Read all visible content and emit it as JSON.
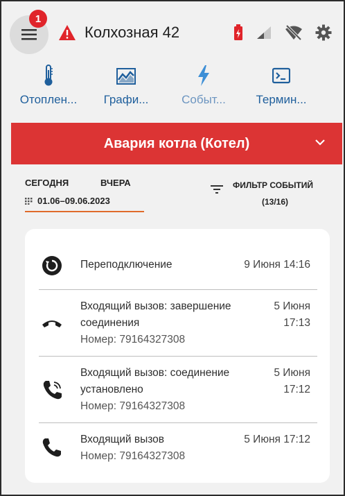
{
  "header": {
    "notification_count": "1",
    "title": "Колхозная 42",
    "icons": [
      "menu-icon",
      "warning-icon",
      "battery-icon",
      "signal-icon",
      "no-wifi-icon",
      "gear-icon"
    ]
  },
  "nav": {
    "items": [
      {
        "label": "Отоплен...",
        "icon": "thermometer-icon"
      },
      {
        "label": "Графи...",
        "icon": "chart-icon"
      },
      {
        "label": "Событ...",
        "icon": "lightning-icon"
      },
      {
        "label": "Термин...",
        "icon": "terminal-icon"
      }
    ]
  },
  "alarm": {
    "text": "Авария котла (Котел)",
    "color": "#dc3434"
  },
  "filters": {
    "today": "СЕГОДНЯ",
    "yesterday": "ВЧЕРА",
    "date_range": "01.06–09.06.2023",
    "filter_label": "ФИЛЬТР СОБЫТИЙ",
    "filter_count": "(13/16)"
  },
  "events": [
    {
      "icon": "reconnect-icon",
      "title": "Переподключение",
      "sub": "",
      "time": "9 Июня 14:16"
    },
    {
      "icon": "hangup-icon",
      "title": "Входящий вызов: завершение соединения",
      "sub": "Номер: 79164327308",
      "time": "5 Июня 17:13"
    },
    {
      "icon": "phone-ringing-icon",
      "title": "Входящий вызов: соединение установлено",
      "sub": "Номер: 79164327308",
      "time": "5 Июня 17:12"
    },
    {
      "icon": "phone-icon",
      "title": "Входящий вызов",
      "sub": "Номер: 79164327308",
      "time": "5 Июня 17:12"
    }
  ],
  "colors": {
    "accent_blue": "#1f5f9c",
    "alarm_red": "#dc3434",
    "badge_red": "#e0242a",
    "underline_orange": "#e06a2a"
  }
}
